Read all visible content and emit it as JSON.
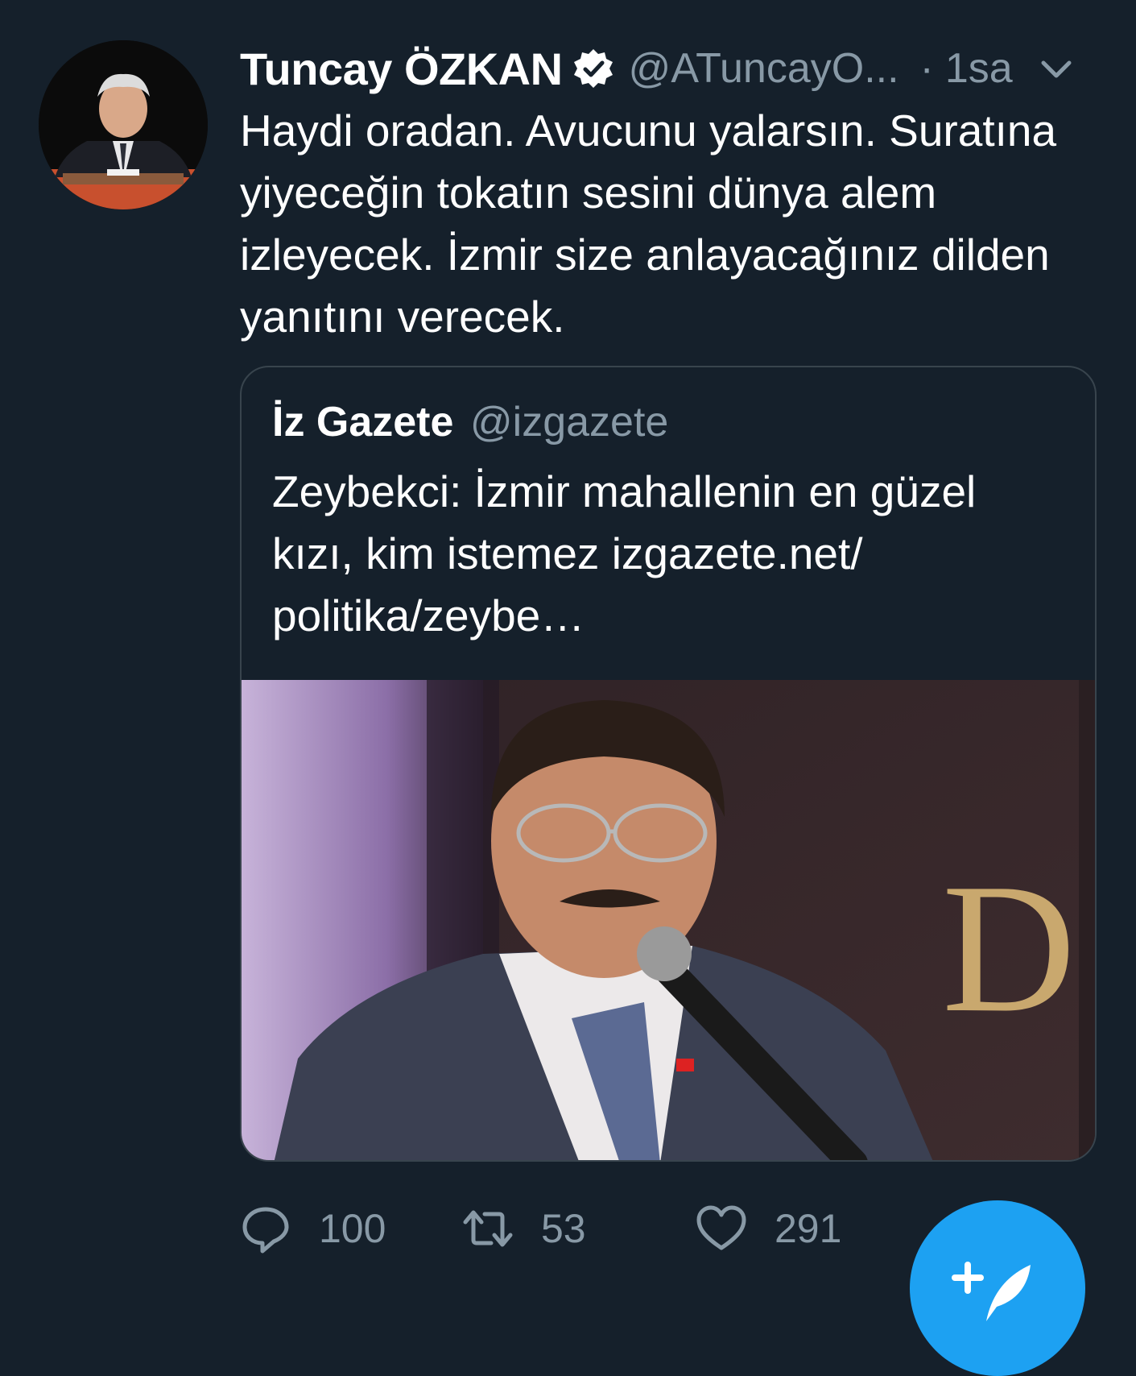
{
  "tweet": {
    "display_name": "Tuncay ÖZKAN",
    "handle": "@ATuncayO...",
    "separator": "·",
    "time": "1sa",
    "text": "Haydi oradan. Avucunu yalarsın. Suratına yiyeceğin tokatın sesini dünya alem izleyecek. İzmir size anlayacağınız dilden yanıtını verecek."
  },
  "quote": {
    "display_name": "İz Gazete",
    "handle": "@izgazete",
    "text": "Zeybekci: İzmir mahallenin en güzel kızı, kim istemez izgazete.net/ politika/zeybe…",
    "image_sign_letter": "D"
  },
  "actions": {
    "replies": "100",
    "retweets": "53",
    "likes": "291"
  },
  "colors": {
    "background": "#15202b",
    "secondary_text": "#8899a6",
    "border": "#38444d",
    "accent": "#1da1f2"
  },
  "icons": {
    "verified": "verified-badge-icon",
    "caret": "chevron-down-icon",
    "reply": "reply-bubble-icon",
    "retweet": "retweet-icon",
    "like": "heart-icon",
    "compose": "compose-tweet-icon"
  }
}
